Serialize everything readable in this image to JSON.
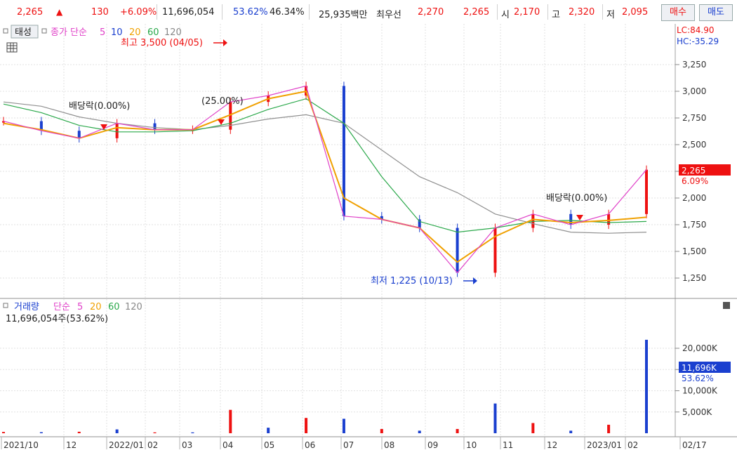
{
  "topbar": {
    "price": "2,265",
    "up_arrow": "▲",
    "change": "130",
    "change_pct": "+6.09%",
    "volume": "11,696,054",
    "turnover1": "53.62%",
    "turnover2": "46.34%",
    "amount": "25,935백만",
    "best_bid_label": "최우선",
    "best_ask": "2,270",
    "best_bid": "2,265",
    "open_label": "시",
    "open": "2,170",
    "high_label": "고",
    "high": "2,320",
    "low_label": "저",
    "low": "2,095",
    "buy_button": "매수",
    "sell_button": "매도"
  },
  "price_panel": {
    "legend": {
      "tab": "태성",
      "series_label": "종가 단순",
      "ma": [
        "5",
        "10",
        "20",
        "60",
        "120"
      ]
    },
    "lc_label": "LC:84.90",
    "hc_label": "HC:-35.29",
    "annotations": {
      "high": "최고 3,500 (04/05)",
      "low": "최저 1,225 (10/13)",
      "dividend1": "배당락(0.00%)",
      "split": "(25.00%)",
      "dividend2": "배당락(0.00%)"
    },
    "current_price_tag": "2,265",
    "current_pct_tag": "6.09%"
  },
  "volume_panel": {
    "legend": {
      "title": "거래량",
      "series_label": "단순",
      "ma": [
        "5",
        "20",
        "60",
        "120"
      ]
    },
    "info": "11,696,054주(53.62%)",
    "current_tag": "11,696K",
    "current_pct_tag": "53.62%"
  },
  "x_labels": [
    "2021/10",
    "12",
    "2022/01",
    "02",
    "03",
    "04",
    "05",
    "06",
    "07",
    "08",
    "09",
    "10",
    "11",
    "12",
    "2023/01",
    "02",
    "02/17"
  ],
  "chart_data": [
    {
      "type": "line",
      "panel": "price",
      "ylim": [
        1150,
        3500
      ],
      "yticks": [
        1250,
        1500,
        1750,
        2000,
        2250,
        2500,
        2750,
        3000,
        3250
      ],
      "ytick_labels": [
        "1,250",
        "1,500",
        "1,750",
        "2,000",
        "2,250",
        "2,500",
        "2,750",
        "3,000",
        "3,250"
      ],
      "x_dates": [
        "2021/10",
        "2021/11",
        "2021/12",
        "2022/01",
        "2022/02",
        "2022/03",
        "2022/04",
        "2022/05",
        "2022/06",
        "2022/07",
        "2022/08",
        "2022/09",
        "2022/10",
        "2022/11",
        "2022/12",
        "2023/01",
        "2023/02",
        "2023/02/17"
      ],
      "series": [
        {
          "name": "5",
          "color": "#e040c8",
          "values": [
            2720,
            2630,
            2560,
            2700,
            2640,
            2640,
            2900,
            2960,
            3050,
            1830,
            1800,
            1720,
            1300,
            1720,
            1850,
            1750,
            1850,
            2265
          ]
        },
        {
          "name": "20",
          "color": "#f0a000",
          "values": [
            2700,
            2640,
            2560,
            2660,
            2640,
            2640,
            2780,
            2930,
            3000,
            2000,
            1800,
            1720,
            1400,
            1640,
            1800,
            1770,
            1790,
            1820
          ]
        },
        {
          "name": "60",
          "color": "#2aa84a",
          "values": [
            2880,
            2800,
            2680,
            2620,
            2620,
            2630,
            2700,
            2830,
            2930,
            2700,
            2200,
            1780,
            1680,
            1720,
            1780,
            1790,
            1770,
            1780
          ]
        },
        {
          "name": "120",
          "color": "#909090",
          "values": [
            2900,
            2860,
            2760,
            2700,
            2660,
            2640,
            2680,
            2740,
            2780,
            2700,
            2450,
            2200,
            2050,
            1850,
            1760,
            1680,
            1670,
            1680
          ]
        }
      ]
    },
    {
      "type": "bar",
      "panel": "volume",
      "unit": "K",
      "ylim": [
        0,
        23000
      ],
      "yticks": [
        5000,
        10000,
        15000,
        20000
      ],
      "ytick_labels": [
        "5,000K",
        "10,000K",
        "15,000K",
        "20,000K"
      ],
      "categories": [
        "2021/10",
        "2021/11",
        "2021/12",
        "2022/01",
        "2022/02",
        "2022/03",
        "2022/04",
        "2022/05",
        "2022/06",
        "2022/07",
        "2022/08",
        "2022/09",
        "2022/10",
        "2022/11",
        "2022/12",
        "2023/01",
        "2023/02",
        "2023/02/17"
      ],
      "values": [
        300,
        250,
        350,
        900,
        200,
        200,
        5500,
        1300,
        3600,
        3400,
        1000,
        600,
        1000,
        7000,
        2400,
        600,
        2000,
        22000
      ]
    }
  ]
}
